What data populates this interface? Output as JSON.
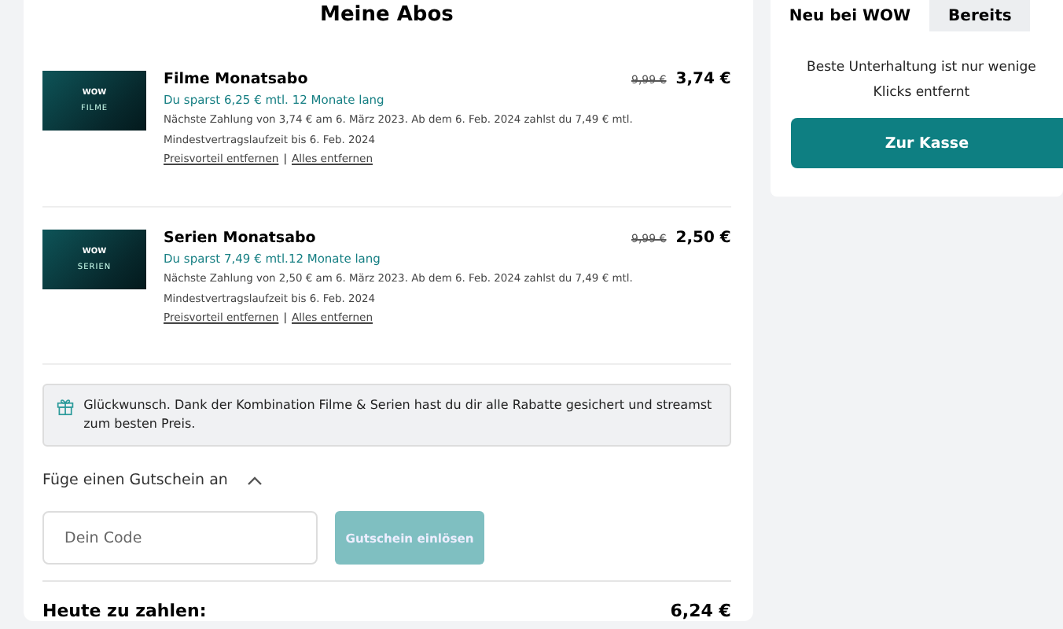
{
  "cart": {
    "title": "Meine Abos",
    "items": [
      {
        "logo": "WOW",
        "label": "FILME",
        "name": "Filme Monatsabo",
        "old_price": "9,99 €",
        "price": "3,74 €",
        "saving": "Du sparst 6,25 € mtl. 12 Monate lang",
        "details": "Nächste Zahlung von 3,74 € am 6. März 2023. Ab dem 6. Feb. 2024 zahlst du 7,49 € mtl. Mindestvertragslaufzeit bis 6. Feb. 2024",
        "links": [
          "Preisvorteil entfernen",
          "Alles entfernen"
        ],
        "separator": "|"
      },
      {
        "logo": "WOW",
        "label": "SERIEN",
        "name": "Serien Monatsabo",
        "old_price": "9,99 €",
        "price": "2,50 €",
        "saving": "Du sparst 7,49 € mtl.12 Monate lang",
        "details": "Nächste Zahlung von 2,50 € am 6. März 2023. Ab dem 6. Feb. 2024 zahlst du 7,49 € mtl. Mindestvertragslaufzeit bis 6. Feb. 2024",
        "links": [
          "Preisvorteil entfernen",
          "Alles entfernen"
        ],
        "separator": "|"
      }
    ],
    "notice": "Glückwunsch. Dank der Kombination Filme & Serien hast du dir alle Rabatte gesichert und streamst zum besten Preis.",
    "voucher": {
      "label": "Füge einen Gutschein an",
      "expanded": true,
      "placeholder": "Dein Code",
      "button": "Gutschein einlösen",
      "disabled": true
    },
    "total": {
      "label": "Heute zu zahlen:",
      "value": "6,24 €"
    }
  },
  "sidebar": {
    "tabs": [
      {
        "label": "Neu bei WOW",
        "selected": true
      },
      {
        "label": "Bereits",
        "selected": false
      }
    ],
    "text": "Beste Unterhaltung ist nur wenige Klicks entfernt",
    "button": "Zur Kasse"
  }
}
